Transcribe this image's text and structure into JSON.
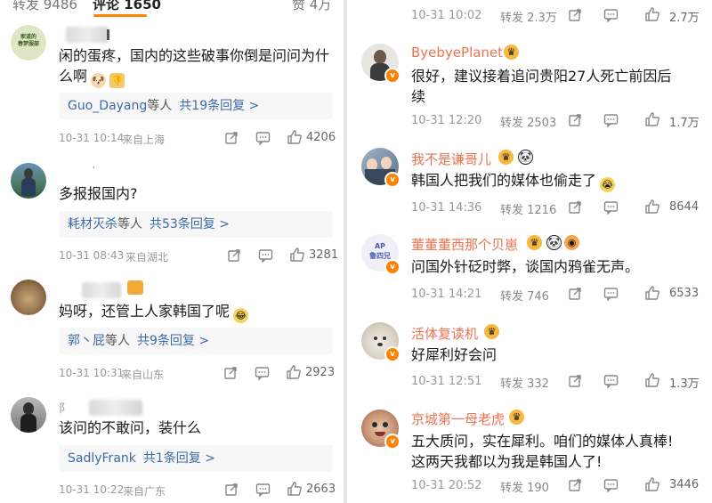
{
  "header": {
    "repost_tab": "转发 9486",
    "comment_tab": "评论 1650",
    "like_tab": "赞 4万"
  },
  "left": {
    "comments": [
      {
        "avatar_text": "家道的\n春梦服部",
        "text_line1": "闲的蛋疼，国内的这些破事你倒是问问为什",
        "text_line2": "么啊",
        "reply_name": "Guo_Dayang",
        "reply_suffix": "等人",
        "reply_count": "共19条回复 >",
        "time": "10-31 10:14",
        "location": "来自上海",
        "likes": "4206"
      },
      {
        "text_line1": "多报报国内?",
        "reply_name": "耗材灭杀",
        "reply_suffix": "等人",
        "reply_count": "共53条回复 >",
        "time": "10-31 08:43",
        "location": "来自湖北",
        "likes": "3281"
      },
      {
        "text_line1": "妈呀，还管上人家韩国了呢",
        "reply_name": "郭丶屁",
        "reply_suffix": "等人",
        "reply_count": "共9条回复 >",
        "time": "10-31 10:31",
        "location": "来自山东",
        "likes": "2923"
      },
      {
        "name_prefix": "阝",
        "text_line1": "该问的不敢问，装什么",
        "reply_name": "SadlyFrank",
        "reply_suffix": "",
        "reply_count": "共1条回复 >",
        "time": "10-31 10:22",
        "location": "来自广东",
        "likes": "2663"
      }
    ]
  },
  "right": {
    "top_row": {
      "time": "10-31 10:02",
      "repost": "转发 2.3万",
      "likes": "2.7万"
    },
    "comments": [
      {
        "username": "ByebyePlanet",
        "text_line1": "很好，建议接着追问贵阳27人死亡前因后",
        "text_line2": "续",
        "time": "10-31 12:20",
        "repost": "转发 2503",
        "likes": "1.7万"
      },
      {
        "username": "我不是谦哥儿",
        "text_line1": "韩国人把我们的媒体也偷走了",
        "time": "10-31 14:36",
        "repost": "转发 1216",
        "likes": "8644"
      },
      {
        "username": "董董董西那个贝崽",
        "avatar_text": "AP\n鲁四兄",
        "text_line1": "问国外针砭时弊，谈国内鸦雀无声。",
        "time": "10-31 14:21",
        "repost": "转发 746",
        "likes": "6533"
      },
      {
        "username": "活体复读机",
        "text_line1": "好犀利好会问",
        "time": "10-31 12:51",
        "repost": "转发 332",
        "likes": "1.3万"
      },
      {
        "username": "京城第一母老虎",
        "text_line1": "五大质问，实在犀利。咱们的媒体人真棒!",
        "text_line2": "这两天我都以为我是韩国人了!",
        "time": "10-31 20:52",
        "repost": "转发 190",
        "likes": "3446"
      }
    ]
  }
}
